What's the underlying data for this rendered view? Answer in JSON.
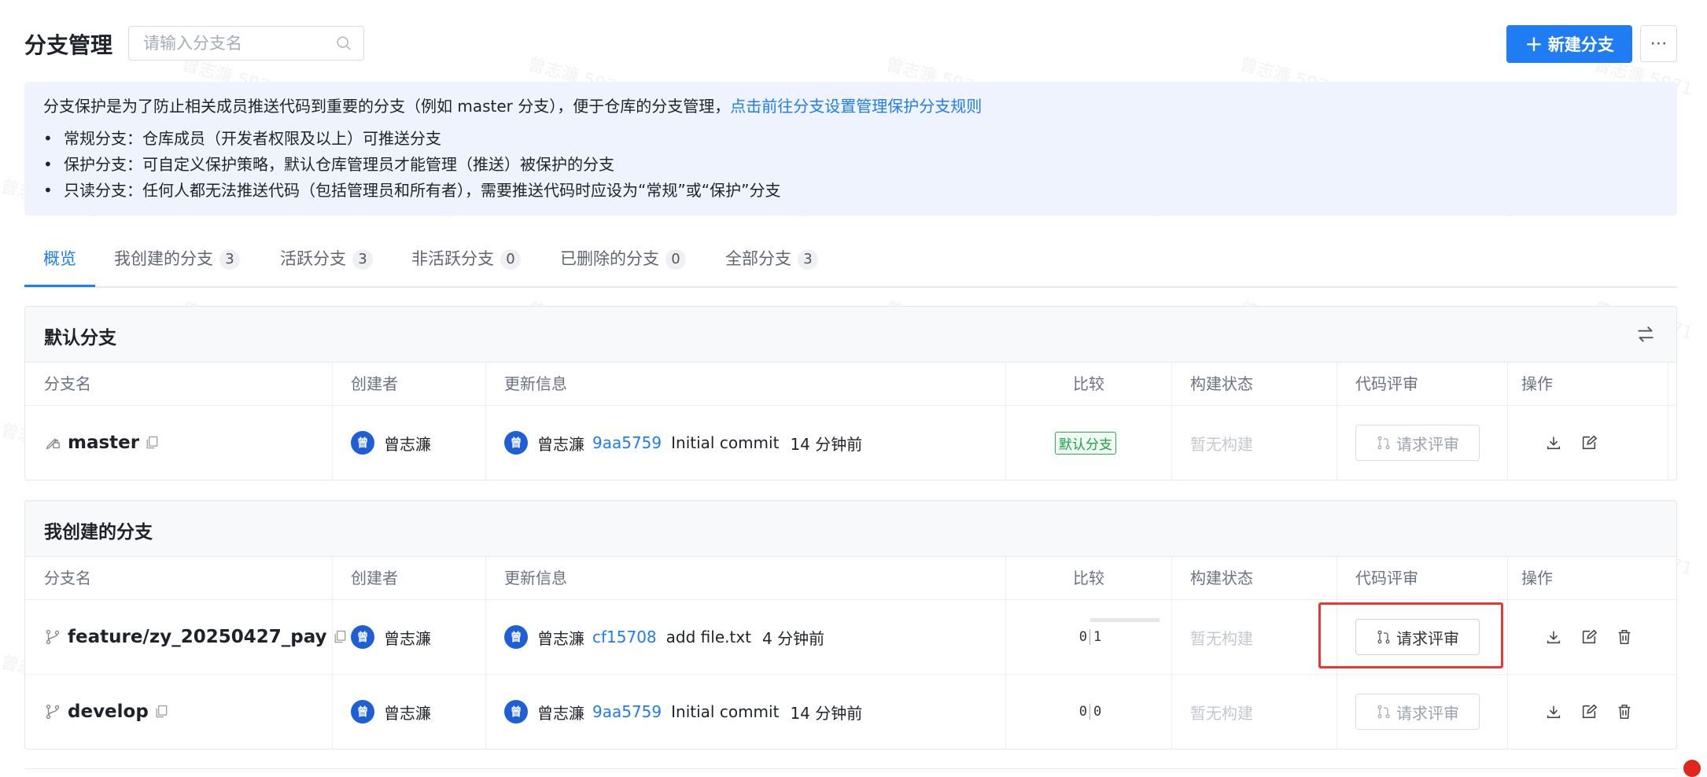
{
  "header": {
    "title": "分支管理",
    "search_placeholder": "请输入分支名",
    "new_branch_label": "新建分支",
    "more_label": "⋯"
  },
  "watermark": "曾志濂 5971",
  "info": {
    "text": "分支保护是为了防止相关成员推送代码到重要的分支（例如 master 分支），便于仓库的分支管理，",
    "link": "点击前往分支设置管理保护分支规则",
    "items": [
      "常规分支：仓库成员（开发者权限及以上）可推送分支",
      "保护分支：可自定义保护策略，默认仓库管理员才能管理（推送）被保护的分支",
      "只读分支：任何人都无法推送代码（包括管理员和所有者），需要推送代码时应设为“常规”或“保护”分支"
    ]
  },
  "tabs": [
    {
      "label": "概览",
      "count": null
    },
    {
      "label": "我创建的分支",
      "count": "3"
    },
    {
      "label": "活跃分支",
      "count": "3"
    },
    {
      "label": "非活跃分支",
      "count": "0"
    },
    {
      "label": "已删除的分支",
      "count": "0"
    },
    {
      "label": "全部分支",
      "count": "3"
    }
  ],
  "columns": [
    "分支名",
    "创建者",
    "更新信息",
    "比较",
    "构建状态",
    "代码评审",
    "操作"
  ],
  "default_section": {
    "title": "默认分支",
    "rows": [
      {
        "name": "master",
        "creator": "曾志濂",
        "avatar": "曾",
        "updater": "曾志濂",
        "commit": "9aa5759",
        "message": "Initial commit",
        "time": "14 分钟前",
        "compare_tag": "默认分支",
        "build": "暂无构建",
        "review": "请求评审"
      }
    ]
  },
  "mine_section": {
    "title": "我创建的分支",
    "rows": [
      {
        "name": "feature/zy_20250427_pay",
        "creator": "曾志濂",
        "avatar": "曾",
        "updater": "曾志濂",
        "commit": "cf15708",
        "message": "add file.txt",
        "time": "4 分钟前",
        "behind": "0",
        "ahead": "1",
        "build": "暂无构建",
        "review": "请求评审"
      },
      {
        "name": "develop",
        "creator": "曾志濂",
        "avatar": "曾",
        "updater": "曾志濂",
        "commit": "9aa5759",
        "message": "Initial commit",
        "time": "14 分钟前",
        "behind": "0",
        "ahead": "0",
        "build": "暂无构建",
        "review": "请求评审"
      }
    ]
  },
  "colors": {
    "accent": "#1f7cf3",
    "highlight": "#e53935",
    "default_tag": "#1e9e4a"
  }
}
